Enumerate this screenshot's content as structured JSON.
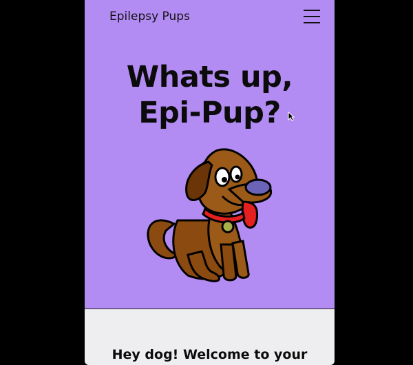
{
  "nav": {
    "brand": "Epilepsy Pups",
    "menu_icon": "hamburger-menu-icon"
  },
  "hero": {
    "title_line1": "Whats up,",
    "title_line2": "Epi-Pup?",
    "image": "cartoon-dog-icon",
    "background": "#b38cf3"
  },
  "welcome": {
    "heading": "Hey dog! Welcome to your",
    "background": "#eeedf0"
  }
}
